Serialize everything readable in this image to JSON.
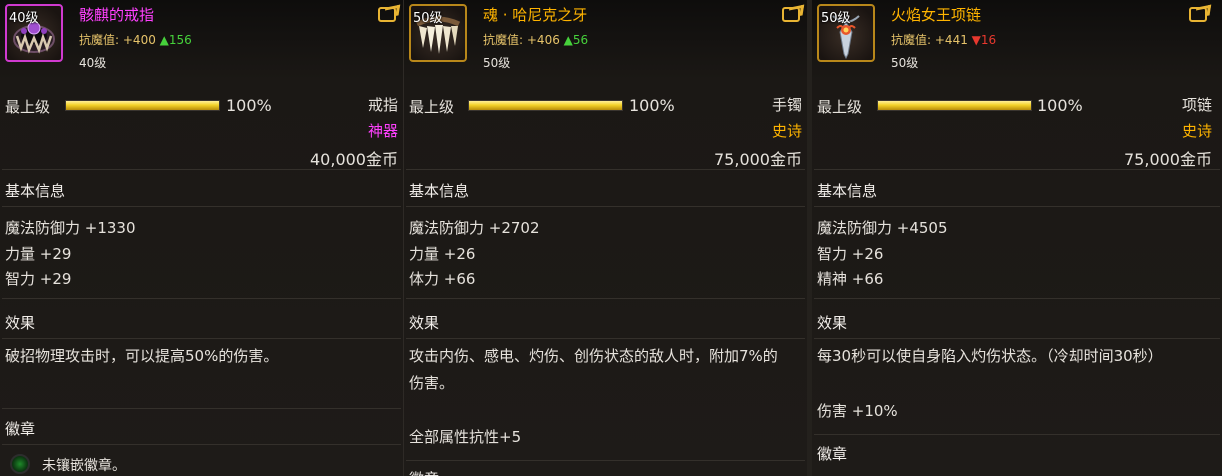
{
  "colors": {
    "artifact": "#ff40ff",
    "epic": "#ffb400",
    "stat_up": "#46d13b",
    "stat_down": "#e8382e",
    "magic_resist": "#e6c36a",
    "bar_fill": "#f3d22a"
  },
  "items": [
    {
      "level_tag": "40级",
      "name": "骸麒的戒指",
      "name_color": "#ff40ff",
      "magic_resist_label": "抗魔值:",
      "magic_resist_value": "+400",
      "resist_delta_arrow": "▲",
      "resist_delta": "156",
      "required_level": "40级",
      "grade_label": "最上级",
      "grade_percent": "100%",
      "grade_fraction": 1.0,
      "slot": "戒指",
      "rarity": "神器",
      "rarity_color": "#ff40ff",
      "price": "40,000金币",
      "basic_info_title": "基本信息",
      "attributes": [
        "魔法防御力 +1330",
        "力量 +29",
        "智力 +29"
      ],
      "effect_title": "效果",
      "effect_text": "破招物理攻击时，可以提高50%的伤害。",
      "emblem_title": "徽章",
      "emblem_text": "未镶嵌徽章。",
      "icon": "ring-icon"
    },
    {
      "level_tag": "50级",
      "name": "魂 · 哈尼克之牙",
      "name_color": "#ffb400",
      "magic_resist_label": "抗魔值:",
      "magic_resist_value": "+406",
      "resist_delta_arrow": "▲",
      "resist_delta": "56",
      "required_level": "50级",
      "grade_label": "最上级",
      "grade_percent": "100%",
      "grade_fraction": 1.0,
      "slot": "手镯",
      "rarity": "史诗",
      "rarity_color": "#ffb400",
      "price": "75,000金币",
      "basic_info_title": "基本信息",
      "attributes": [
        "魔法防御力 +2702",
        "力量 +26",
        "体力 +66"
      ],
      "effect_title": "效果",
      "effect_text": "攻击内伤、感电、灼伤、创伤状态的敌人时，附加7%的伤害。",
      "effect_extra": "全部属性抗性+5",
      "emblem_title": "徽章",
      "icon": "fang-bracelet-icon"
    },
    {
      "level_tag": "50级",
      "name": "火焰女王项链",
      "name_color": "#ffb400",
      "magic_resist_label": "抗魔值:",
      "magic_resist_value": "+441",
      "resist_delta_arrow": "▼",
      "resist_delta": "16",
      "required_level": "50级",
      "grade_label": "最上级",
      "grade_percent": "100%",
      "grade_fraction": 1.0,
      "slot": "项链",
      "rarity": "史诗",
      "rarity_color": "#ffb400",
      "price": "75,000金币",
      "basic_info_title": "基本信息",
      "attributes": [
        "魔法防御力 +4505",
        "智力 +26",
        "精神 +66"
      ],
      "effect_title": "效果",
      "effect_text": "每30秒可以使自身陷入灼伤状态。（冷却时间30秒）",
      "effect_extra": "伤害 +10%",
      "emblem_title": "徽章",
      "icon": "flame-necklace-icon"
    }
  ]
}
